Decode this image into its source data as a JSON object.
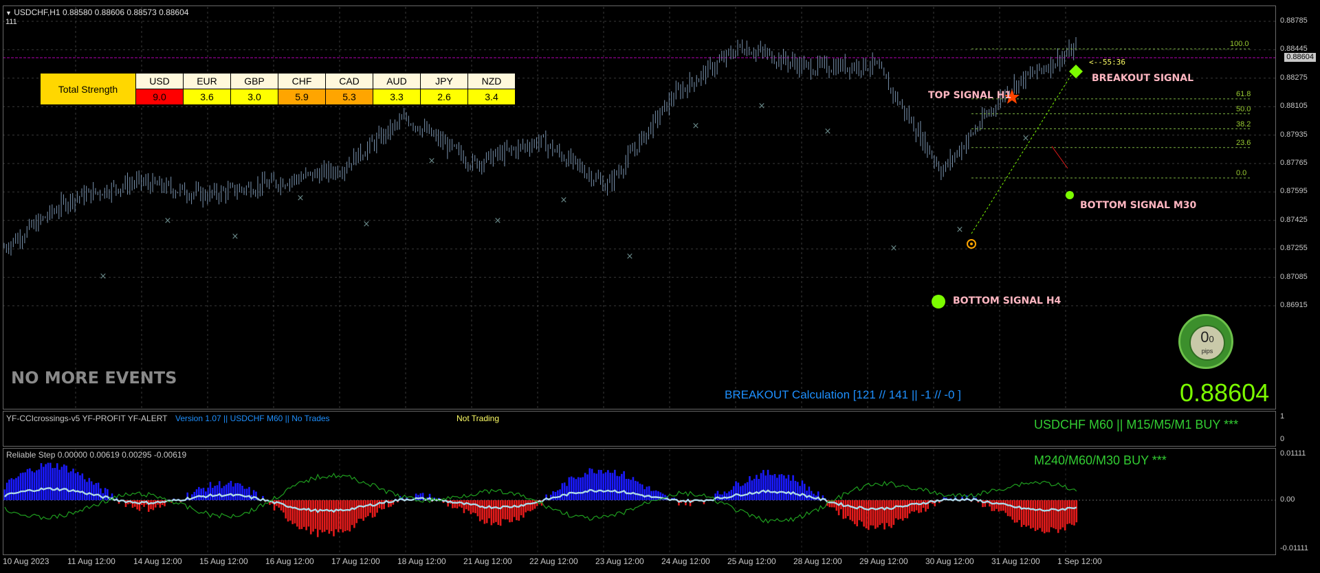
{
  "symbol_info": "USDCHF,H1  0.88580 0.88606 0.88573 0.88604",
  "sub_info": "111",
  "current_price_tag": "0.88604",
  "price_axis": [
    "0.88785",
    "0.88445",
    "0.88275",
    "0.88105",
    "0.87935",
    "0.87765",
    "0.87595",
    "0.87425",
    "0.87255",
    "0.87085",
    "0.86915"
  ],
  "strength": {
    "title": "Total Strength",
    "currencies": [
      "USD",
      "EUR",
      "GBP",
      "CHF",
      "CAD",
      "AUD",
      "JPY",
      "NZD"
    ],
    "values": [
      "9.0",
      "3.6",
      "3.0",
      "5.9",
      "5.3",
      "3.3",
      "2.6",
      "3.4"
    ],
    "colors": [
      "#ff0000",
      "#ffff00",
      "#ffff00",
      "#ffa500",
      "#ffa500",
      "#ffff00",
      "#ffff00",
      "#ffff00"
    ]
  },
  "fib_levels": [
    {
      "label": "100.0",
      "price": 0.88604
    },
    {
      "label": "61.8",
      "price": 0.88275
    },
    {
      "label": "50.0",
      "price": 0.88177
    },
    {
      "label": "38.2",
      "price": 0.88078
    },
    {
      "label": "23.6",
      "price": 0.87955
    },
    {
      "label": "0.0",
      "price": 0.87755
    }
  ],
  "timer_label": "<--55:36",
  "signals": {
    "breakout": "BREAKOUT SIGNAL",
    "top_h1": "TOP SIGNAL H1",
    "bottom_m30": "BOTTOM SIGNAL M30",
    "bottom_h4": "BOTTOM SIGNAL H4"
  },
  "no_more_events": "NO MORE EVENTS",
  "breakout_calc": "BREAKOUT Calculation [121 // 141  || -1 // -0 ]",
  "big_price": "0.88604",
  "pips": {
    "value": "0",
    "sub": "0",
    "unit": "pips"
  },
  "middle_panel": {
    "indicators": "YF-CCIcrossings-v5   YF-PROFIT   YF-ALERT",
    "version": "Version 1.07 || USDCHF M60 || No Trades",
    "status": "Not Trading",
    "signal1": "USDCHF M60 || M15/M5/M1 BUY ***",
    "signal2": "M240/M60/M30 BUY ***",
    "axis": [
      "1",
      "0"
    ]
  },
  "bottom_panel": {
    "title": "Reliable Step 0.00000 0.00619 0.00295 -0.00619",
    "axis": [
      "0.01111",
      "0.00",
      "-0.01111"
    ]
  },
  "date_axis": [
    "10 Aug 2023",
    "11 Aug 12:00",
    "14 Aug 12:00",
    "15 Aug 12:00",
    "16 Aug 12:00",
    "17 Aug 12:00",
    "18 Aug 12:00",
    "21 Aug 12:00",
    "22 Aug 12:00",
    "23 Aug 12:00",
    "24 Aug 12:00",
    "25 Aug 12:00",
    "28 Aug 12:00",
    "29 Aug 12:00",
    "30 Aug 12:00",
    "31 Aug 12:00",
    "1 Sep 12:00"
  ],
  "chart_data": {
    "type": "line",
    "x": [
      "10 Aug 2023",
      "11 Aug 12:00",
      "14 Aug 12:00",
      "15 Aug 12:00",
      "16 Aug 12:00",
      "17 Aug 12:00",
      "18 Aug 12:00",
      "21 Aug 12:00",
      "22 Aug 12:00",
      "23 Aug 12:00",
      "24 Aug 12:00",
      "25 Aug 12:00",
      "28 Aug 12:00",
      "29 Aug 12:00",
      "30 Aug 12:00",
      "31 Aug 12:00",
      "1 Sep 12:00"
    ],
    "series": [
      {
        "values": [
          0.873,
          0.8762,
          0.8773,
          0.8764,
          0.8772,
          0.8781,
          0.8815,
          0.8785,
          0.88,
          0.877,
          0.883,
          0.8862,
          0.8848,
          0.885,
          0.878,
          0.8835,
          0.88604
        ]
      }
    ],
    "ylim": [
      0.8688,
      0.8885
    ]
  },
  "colors": {
    "bull": "#1a1aff",
    "bear": "#e51b1b",
    "signal_line": "#add8e6",
    "green_line": "#1f9e1f",
    "candles": "#7a94b0",
    "accent_green": "#7cfc00",
    "cyan_text": "#1e90ff"
  }
}
